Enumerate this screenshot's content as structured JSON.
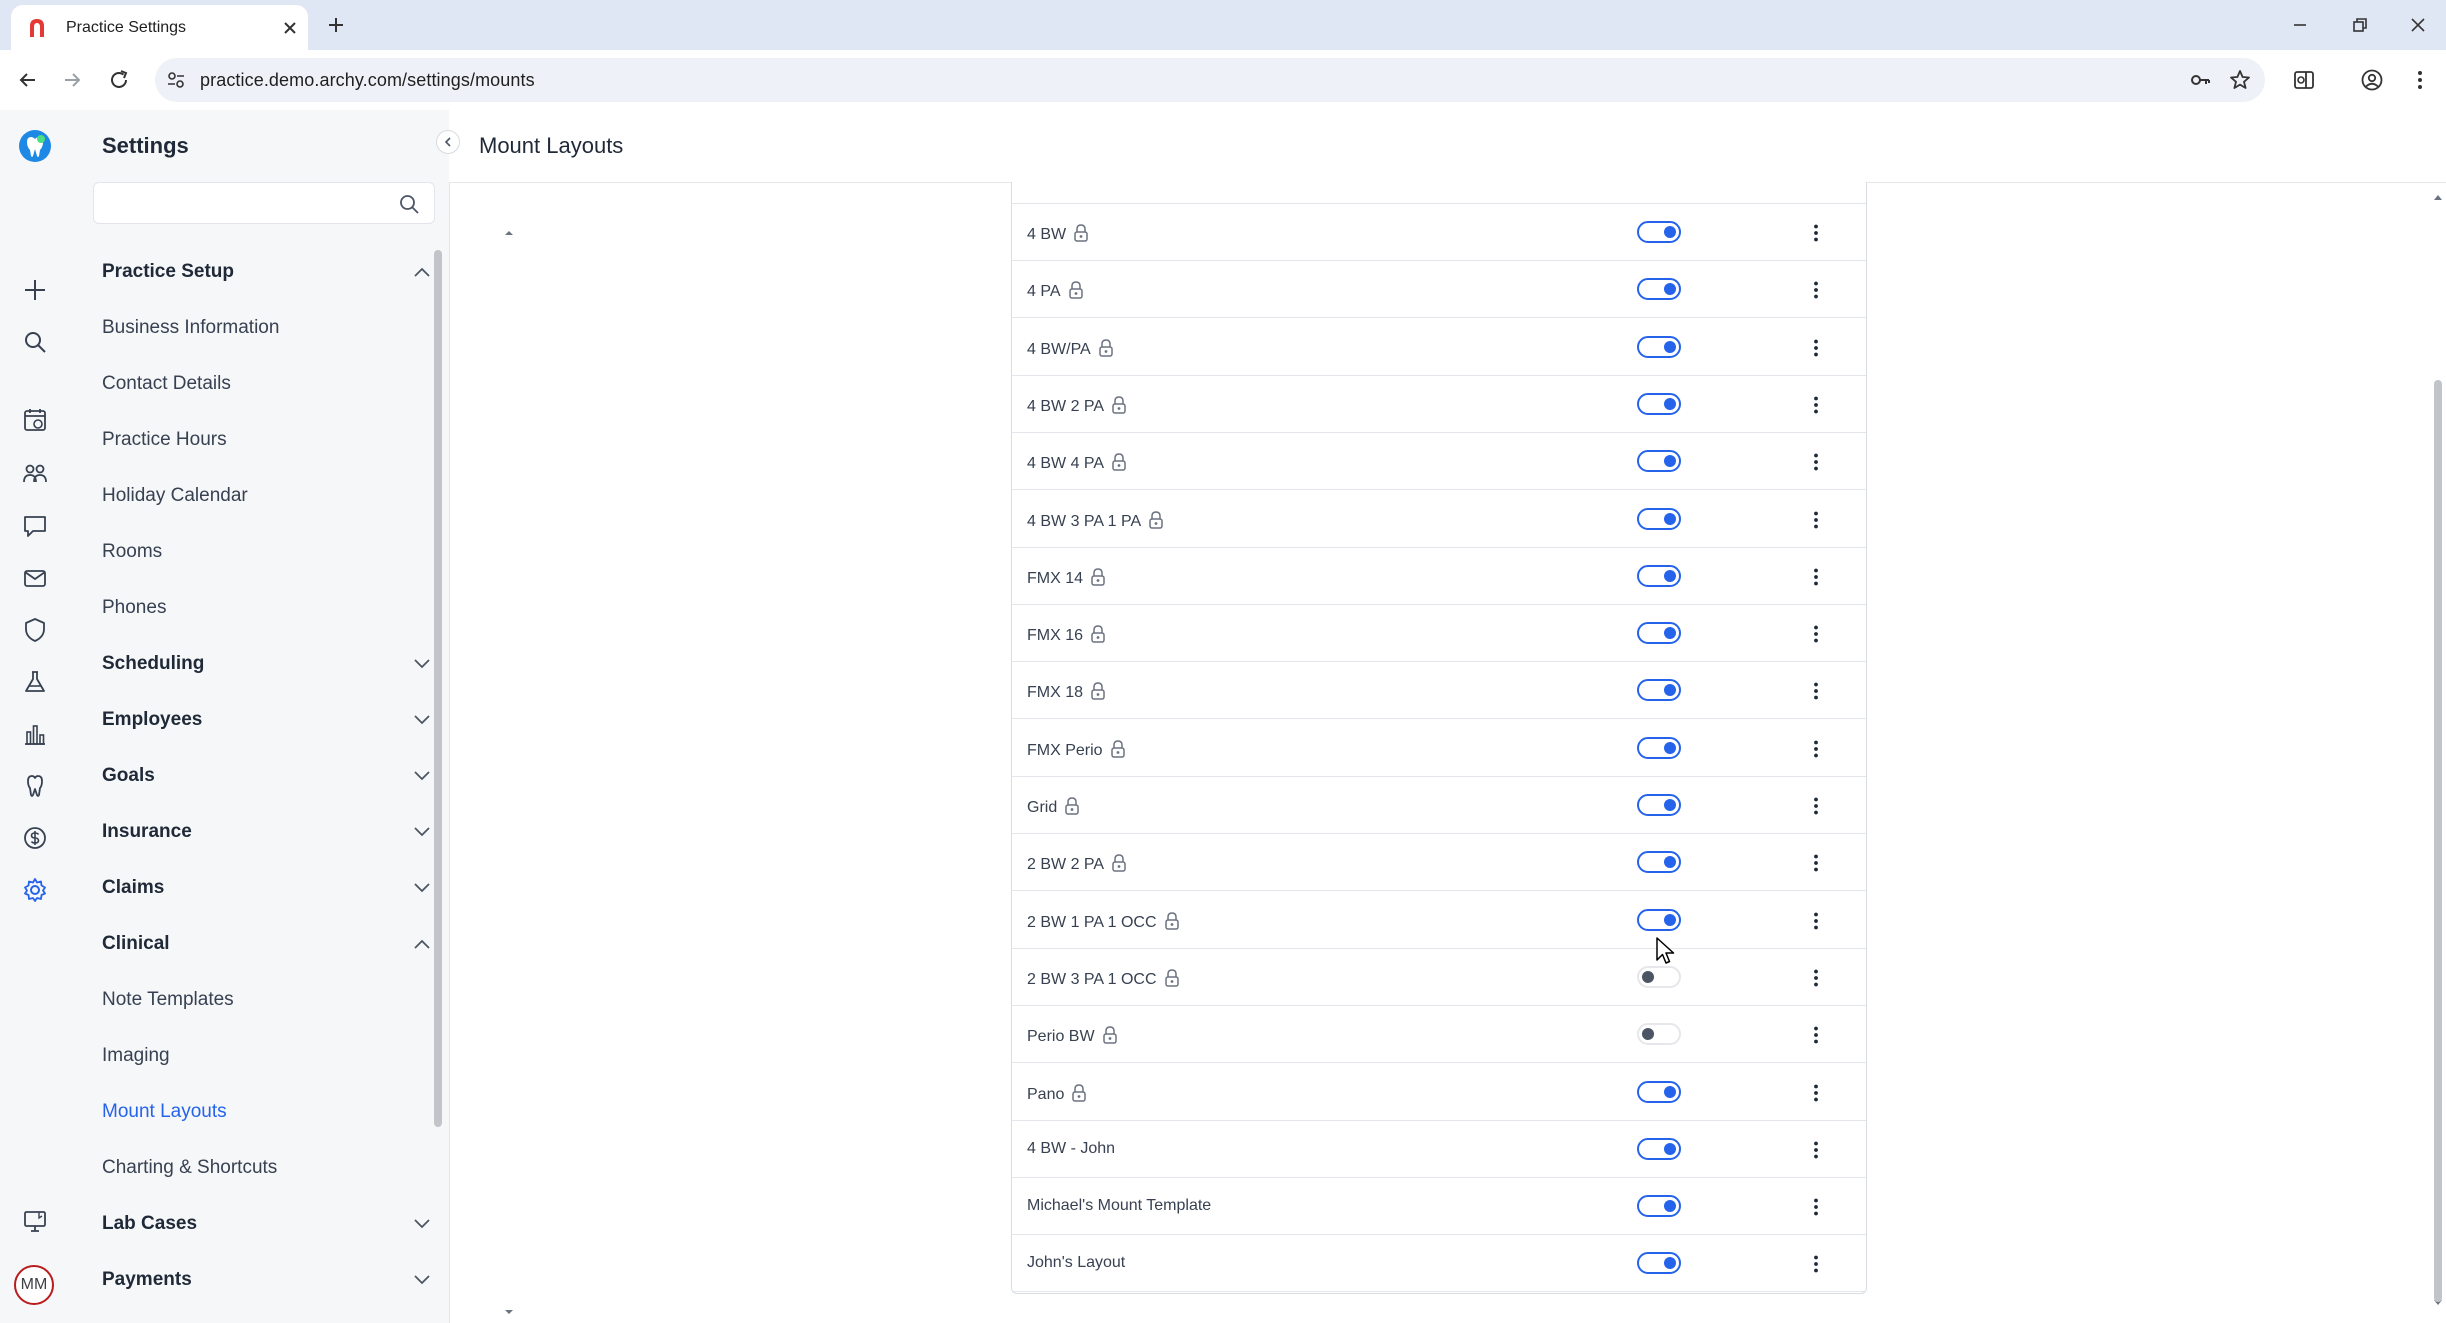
{
  "browser": {
    "tab_title": "Practice Settings",
    "url": "practice.demo.archy.com/settings/mounts"
  },
  "rail": {
    "avatar_initials": "MM"
  },
  "sidebar": {
    "title": "Settings",
    "search_placeholder": "",
    "groups": [
      {
        "label": "Practice Setup",
        "expanded": true,
        "items": [
          "Business Information",
          "Contact Details",
          "Practice Hours",
          "Holiday Calendar",
          "Rooms",
          "Phones"
        ]
      },
      {
        "label": "Scheduling",
        "expanded": false
      },
      {
        "label": "Employees",
        "expanded": false
      },
      {
        "label": "Goals",
        "expanded": false
      },
      {
        "label": "Insurance",
        "expanded": false
      },
      {
        "label": "Claims",
        "expanded": false
      },
      {
        "label": "Clinical",
        "expanded": true,
        "items": [
          "Note Templates",
          "Imaging",
          "Mount Layouts",
          "Charting & Shortcuts"
        ]
      },
      {
        "label": "Lab Cases",
        "expanded": false
      },
      {
        "label": "Payments",
        "expanded": false
      }
    ],
    "active_item": "Mount Layouts"
  },
  "main": {
    "title": "Mount Layouts",
    "layouts": [
      {
        "name": "4 BW",
        "locked": true,
        "enabled": true
      },
      {
        "name": "4 PA",
        "locked": true,
        "enabled": true
      },
      {
        "name": "4 BW/PA",
        "locked": true,
        "enabled": true
      },
      {
        "name": "4 BW 2 PA",
        "locked": true,
        "enabled": true
      },
      {
        "name": "4 BW 4 PA",
        "locked": true,
        "enabled": true
      },
      {
        "name": "4 BW 3 PA 1 PA",
        "locked": true,
        "enabled": true
      },
      {
        "name": "FMX 14",
        "locked": true,
        "enabled": true
      },
      {
        "name": "FMX 16",
        "locked": true,
        "enabled": true
      },
      {
        "name": "FMX 18",
        "locked": true,
        "enabled": true
      },
      {
        "name": "FMX Perio",
        "locked": true,
        "enabled": true
      },
      {
        "name": "Grid",
        "locked": true,
        "enabled": true
      },
      {
        "name": "2 BW 2 PA",
        "locked": true,
        "enabled": true
      },
      {
        "name": "2 BW 1 PA 1 OCC",
        "locked": true,
        "enabled": true
      },
      {
        "name": "2 BW 3 PA 1 OCC",
        "locked": true,
        "enabled": false
      },
      {
        "name": "Perio BW",
        "locked": true,
        "enabled": false
      },
      {
        "name": "Pano",
        "locked": true,
        "enabled": true
      },
      {
        "name": "4 BW - John",
        "locked": false,
        "enabled": true
      },
      {
        "name": "Michael's Mount Template",
        "locked": false,
        "enabled": true
      },
      {
        "name": "John's Layout",
        "locked": false,
        "enabled": true
      }
    ]
  },
  "colors": {
    "accent": "#2563eb",
    "rail_bg": "#f6f7f9",
    "tabbar_bg": "#dfe6f4",
    "brand_red": "#e53935"
  }
}
